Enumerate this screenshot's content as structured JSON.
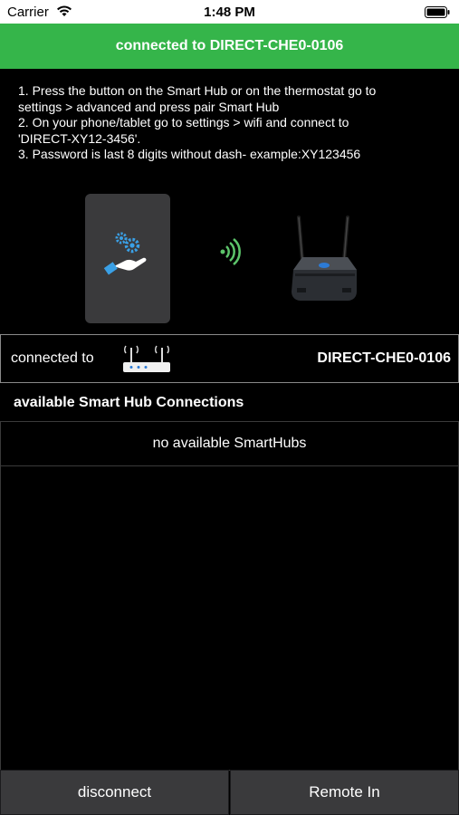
{
  "status_bar": {
    "carrier": "Carrier",
    "time": "1:48 PM"
  },
  "banner": {
    "text": "connected to DIRECT-CHE0-0106",
    "color": "#35b54a"
  },
  "instructions": [
    "1. Press the button on the Smart Hub or on the thermostat go to",
    "settings > advanced and press pair Smart Hub",
    "2. On your phone/tablet go to settings > wifi and connect to",
    "'DIRECT-XY12-3456'.",
    "3. Password is last 8 digits without dash- example:XY123456"
  ],
  "connection": {
    "label": "connected to",
    "ssid": "DIRECT-CHE0-0106"
  },
  "section": {
    "title": "available Smart Hub Connections"
  },
  "list": {
    "empty_text": "no available SmartHubs"
  },
  "buttons": {
    "disconnect": "disconnect",
    "remote_in": "Remote In"
  },
  "icons": {
    "phone_card": "hand-gears-icon",
    "signal": "wifi-signal-icon",
    "router": "router-icon",
    "row_router": "router-small-icon"
  }
}
